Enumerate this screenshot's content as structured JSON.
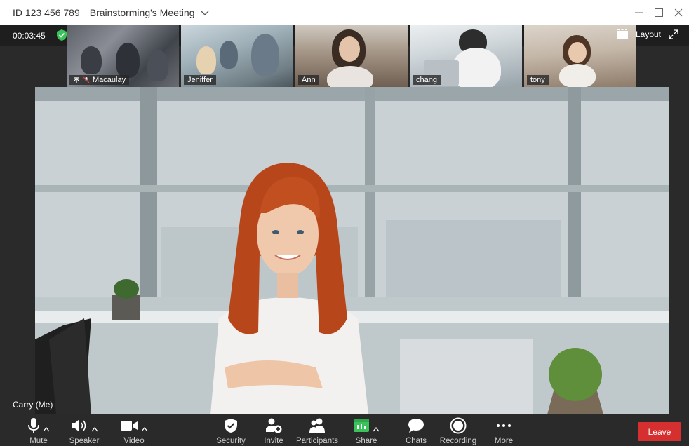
{
  "titlebar": {
    "meeting_id": "ID 123 456 789",
    "meeting_name": "Brainstorming's Meeting"
  },
  "status": {
    "timer": "00:03:45",
    "layout_label": "Layout",
    "accent_green": "#3cc25a"
  },
  "participants_thumbs": [
    {
      "name": "Macaulay",
      "muted": true
    },
    {
      "name": "Jeniffer"
    },
    {
      "name": "Ann"
    },
    {
      "name": "chang"
    },
    {
      "name": "tony"
    }
  ],
  "main_video": {
    "speaker_label": "Carry  (Me)"
  },
  "toolbar": {
    "mute": "Mute",
    "speaker": "Speaker",
    "video": "Video",
    "security": "Security",
    "invite": "Invite",
    "participants": "Participants",
    "share": "Share",
    "chats": "Chats",
    "recording": "Recording",
    "more": "More",
    "leave": "Leave",
    "leave_color": "#d52f2f"
  }
}
